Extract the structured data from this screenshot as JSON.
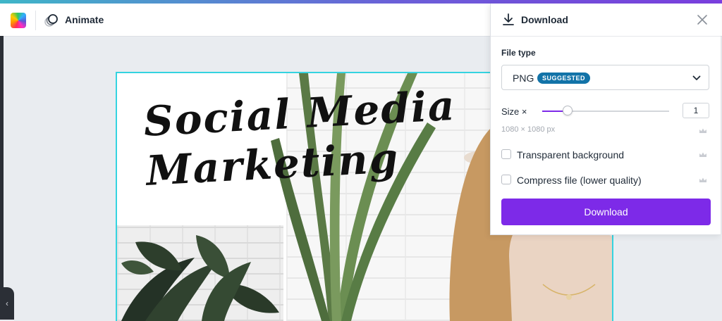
{
  "toolbar": {
    "animate_label": "Animate"
  },
  "canvas": {
    "headline_line1": "Social Media",
    "headline_line2": "Marketing"
  },
  "download_panel": {
    "title": "Download",
    "file_type_label": "File type",
    "file_type_value": "PNG",
    "suggested_badge": "SUGGESTED",
    "size_label": "Size ×",
    "size_value": "1",
    "size_slider_fraction": 0.2,
    "dimensions": "1080 × 1080 px",
    "transparent_background": {
      "label": "Transparent background",
      "checked": false
    },
    "compress_file": {
      "label": "Compress file (lower quality)",
      "checked": false
    },
    "download_button": "Download"
  },
  "colors": {
    "accent": "#7d2ae8",
    "badge": "#1273a8",
    "selection_border": "#34d3e0",
    "premium_crown": "#c9ccd2"
  },
  "icons": {
    "color": "color-picker-icon",
    "animate": "animate-icon",
    "download": "download-icon",
    "close": "close-icon",
    "chevron": "chevron-down-icon",
    "premium": "crown-icon",
    "rail": "chevron-left-icon"
  }
}
